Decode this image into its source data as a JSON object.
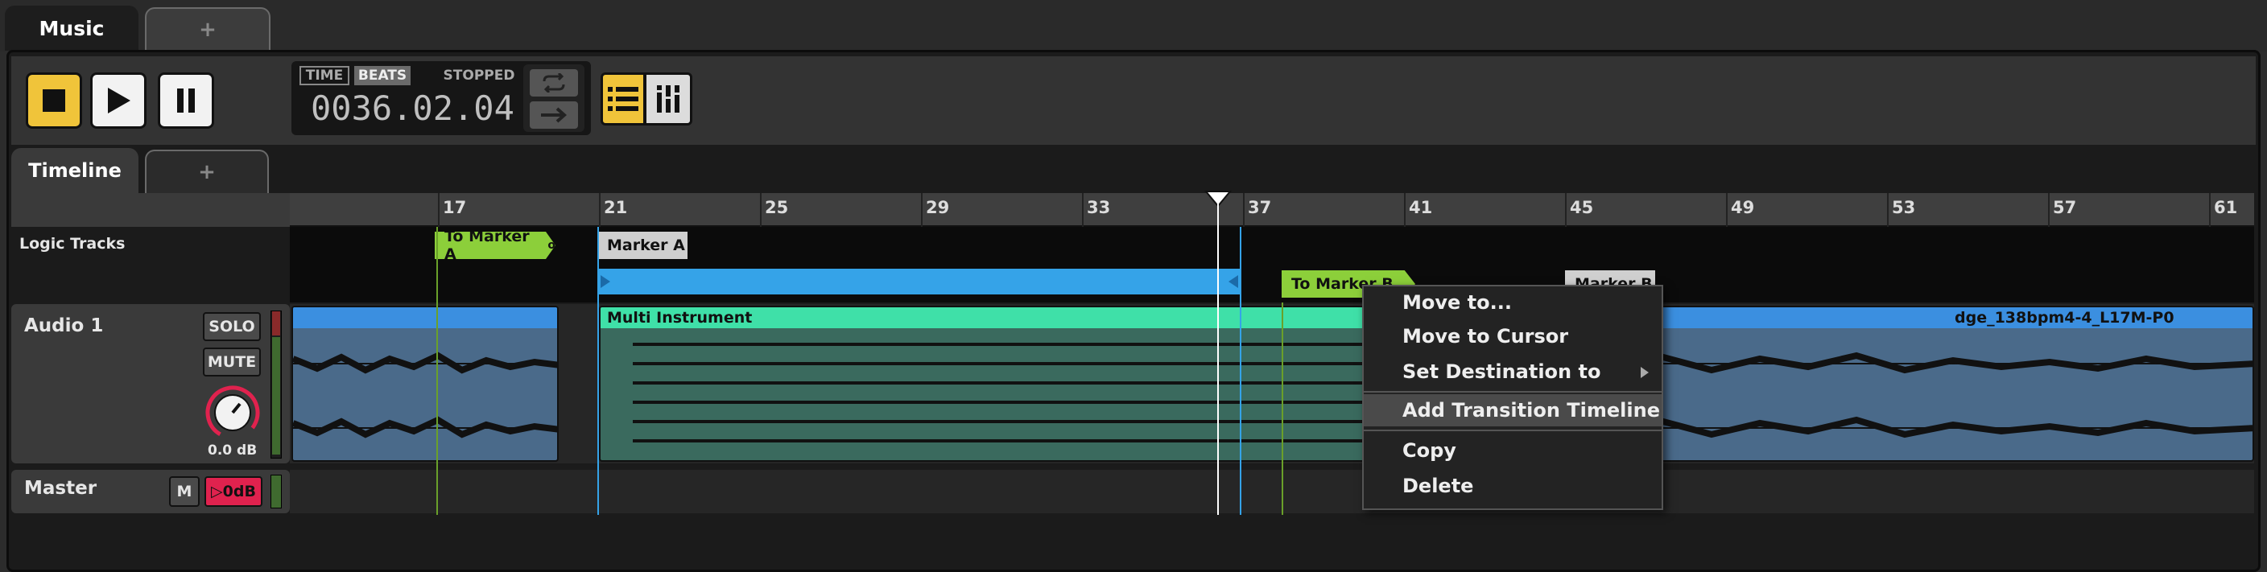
{
  "app": {
    "tabs": [
      {
        "label": "Music"
      },
      {
        "label": "+"
      }
    ]
  },
  "transport": {
    "time_tag": "TIME",
    "beats_tag": "BEATS",
    "status": "STOPPED",
    "position": "0036.02.04"
  },
  "timeline_tabs": [
    {
      "label": "Timeline"
    },
    {
      "label": "+"
    }
  ],
  "ruler": {
    "labels": [
      "17",
      "21",
      "25",
      "29",
      "33",
      "37",
      "41",
      "45",
      "49",
      "53",
      "57",
      "61"
    ]
  },
  "logic": {
    "label": "Logic Tracks",
    "markers": [
      {
        "label": "To Marker A",
        "color": "#8ccf3a"
      },
      {
        "label": "Marker A",
        "color": "#cfcfcf"
      },
      {
        "label": "To Marker B",
        "color": "#8ccf3a"
      },
      {
        "label": "Marker B",
        "color": "#cfcfcf"
      }
    ]
  },
  "tracks": [
    {
      "name": "Audio 1",
      "solo": "SOLO",
      "mute": "MUTE",
      "volume": "0.0 dB"
    },
    {
      "name": "Master",
      "mute": "M",
      "volume": "▷0dB"
    }
  ],
  "clips": [
    {
      "label": ""
    },
    {
      "label": "Multi Instrument",
      "color": "#3fe0a8"
    },
    {
      "label": "dge_138bpm4-4_L17M-P0",
      "color": "#3b8fe0"
    }
  ],
  "context_menu": {
    "items": [
      {
        "label": "Move to..."
      },
      {
        "label": "Move to Cursor"
      },
      {
        "label": "Set Destination to"
      },
      {
        "label": "Add Transition Timeline"
      },
      {
        "label": "Copy"
      },
      {
        "label": "Delete"
      }
    ]
  },
  "colors": {
    "accent": "#f0c43a",
    "blue_track": "#3b8fe0",
    "green_marker": "#8ccf3a",
    "mute_red": "#e0224e"
  }
}
